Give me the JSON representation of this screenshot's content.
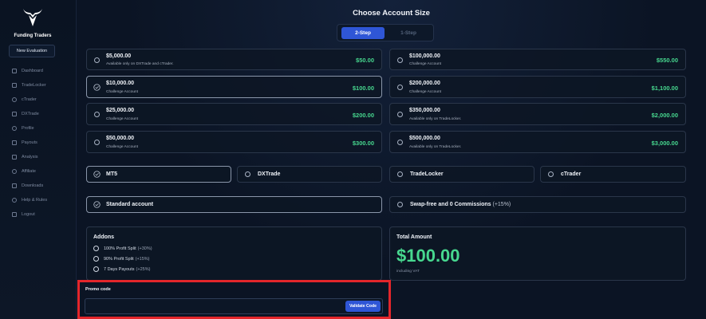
{
  "sidebar": {
    "brand": "Funding Traders",
    "new_evaluation": "New Evaluation",
    "items": [
      {
        "label": "Dashboard",
        "icon": "home-icon"
      },
      {
        "label": "TradeLocker",
        "icon": "chart-icon"
      },
      {
        "label": "cTrader",
        "icon": "c-icon"
      },
      {
        "label": "DXTrade",
        "icon": "dx-icon"
      },
      {
        "label": "Profile",
        "icon": "user-icon"
      },
      {
        "label": "Payouts",
        "icon": "dollar-icon"
      },
      {
        "label": "Analysis",
        "icon": "analysis-icon"
      },
      {
        "label": "Affiliate",
        "icon": "affiliate-icon"
      },
      {
        "label": "Downloads",
        "icon": "download-icon"
      },
      {
        "label": "Help & Rules",
        "icon": "help-icon"
      },
      {
        "label": "Logout",
        "icon": "logout-icon"
      }
    ]
  },
  "header": {
    "title": "Choose Account Size"
  },
  "steps": {
    "active": "2-Step",
    "inactive": "1-Step"
  },
  "accounts": [
    {
      "title": "$5,000.00",
      "subtitle": "Available only on DXTrade and cTrader.",
      "price": "$50.00",
      "selected": false
    },
    {
      "title": "$10,000.00",
      "subtitle": "Challenge Account",
      "price": "$100.00",
      "selected": true
    },
    {
      "title": "$25,000.00",
      "subtitle": "Challenge Account",
      "price": "$200.00",
      "selected": false
    },
    {
      "title": "$50,000.00",
      "subtitle": "Challenge Account",
      "price": "$300.00",
      "selected": false
    },
    {
      "title": "$100,000.00",
      "subtitle": "Challenge Account",
      "price": "$550.00",
      "selected": false
    },
    {
      "title": "$200,000.00",
      "subtitle": "Challenge Account",
      "price": "$1,100.00",
      "selected": false
    },
    {
      "title": "$350,000.00",
      "subtitle": "Available only on TradeLocker.",
      "price": "$2,000.00",
      "selected": false
    },
    {
      "title": "$500,000.00",
      "subtitle": "Available only on TradeLocker.",
      "price": "$3,000.00",
      "selected": false
    }
  ],
  "platforms": [
    {
      "label": "MT5",
      "selected": true
    },
    {
      "label": "DXTrade",
      "selected": false
    },
    {
      "label": "TradeLocker",
      "selected": false
    },
    {
      "label": "cTrader",
      "selected": false
    }
  ],
  "account_types": [
    {
      "label": "Standard account",
      "suffix": "",
      "selected": true
    },
    {
      "label": "Swap-free and 0 Commissions",
      "suffix": "(+15%)",
      "selected": false
    }
  ],
  "addons": {
    "title": "Addons",
    "items": [
      {
        "label": "100% Profit Split",
        "suffix": "(+30%)"
      },
      {
        "label": "90% Profit Split",
        "suffix": "(+15%)"
      },
      {
        "label": "7 Days Payouts",
        "suffix": "(+25%)"
      }
    ]
  },
  "total": {
    "title": "Total Amount",
    "value": "$100.00",
    "note": "including VAT"
  },
  "promo": {
    "label": "Promo code",
    "placeholder": "",
    "button": "Validate Code"
  },
  "colors": {
    "accent": "#2f56d6",
    "price": "#47d88f",
    "highlight": "#e3262b"
  }
}
